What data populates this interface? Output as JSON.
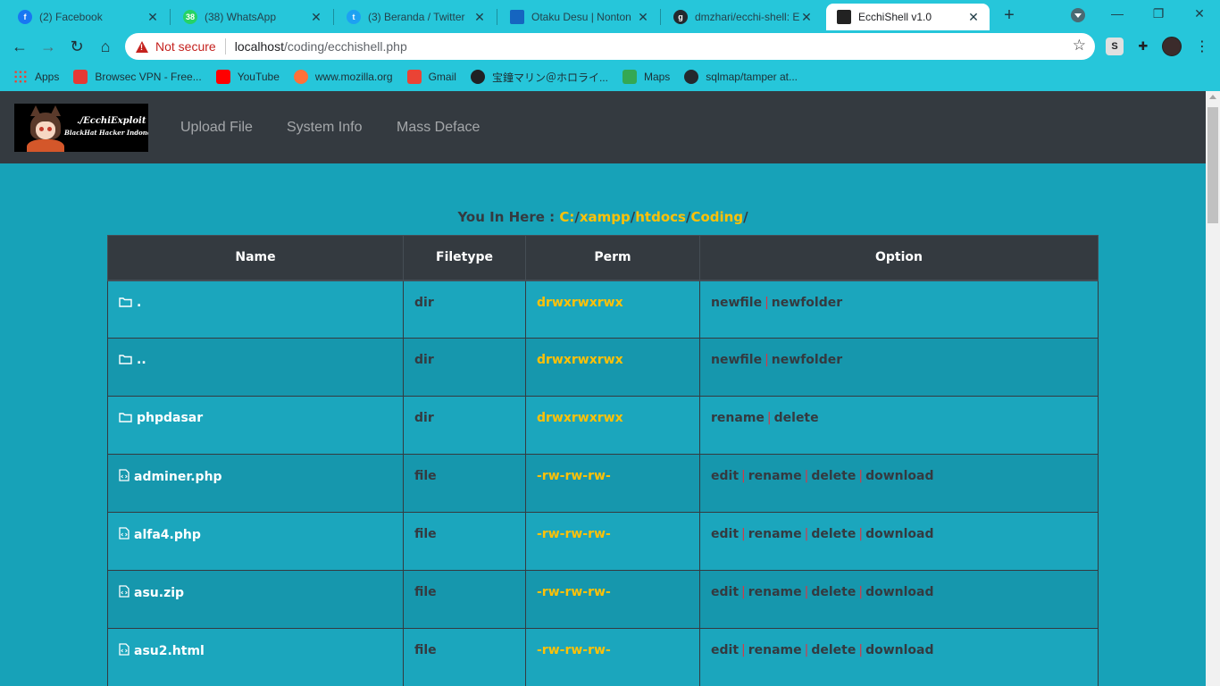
{
  "browser": {
    "tabs": [
      {
        "title": "(2) Facebook",
        "favicon": "facebook-icon",
        "color": "#1877f2",
        "glyph": "f"
      },
      {
        "title": "(38) WhatsApp",
        "favicon": "whatsapp-icon",
        "color": "#25d366",
        "glyph": "38"
      },
      {
        "title": "(3) Beranda / Twitter",
        "favicon": "twitter-icon",
        "color": "#1da1f2",
        "glyph": "t"
      },
      {
        "title": "Otaku Desu | Nonton",
        "favicon": "page-icon",
        "color": "#1565c0",
        "glyph": ""
      },
      {
        "title": "dmzhari/ecchi-shell: Ec",
        "favicon": "github-icon",
        "color": "#24292e",
        "glyph": "g"
      },
      {
        "title": "EcchiShell v1.0",
        "favicon": "ecchishell-icon",
        "color": "#222222",
        "glyph": ""
      }
    ],
    "active_tab": 5,
    "new_tab": "+",
    "window_controls": {
      "minimize": "—",
      "maximize": "❐",
      "close": "✕"
    },
    "nav": {
      "back": "←",
      "forward": "→",
      "reload": "↻",
      "home": "⌂"
    },
    "security_label": "Not secure",
    "url_host": "localhost",
    "url_path": "/coding/ecchishell.php",
    "bookmark_star": "☆",
    "extensions": {
      "s": "S",
      "puzzle": "✚",
      "menu": "⋮"
    },
    "bookmarks": [
      {
        "label": "Apps",
        "icon": "apps-grid-icon",
        "color": "#ea4335"
      },
      {
        "label": "Browsec VPN - Free...",
        "icon": "browsec-icon",
        "color": "#e53935"
      },
      {
        "label": "YouTube",
        "icon": "youtube-icon",
        "color": "#ff0000"
      },
      {
        "label": "www.mozilla.org",
        "icon": "firefox-icon",
        "color": "#ff7139"
      },
      {
        "label": "Gmail",
        "icon": "gmail-icon",
        "color": "#ea4335"
      },
      {
        "label": "宝鐘マリン＠ホロライ...",
        "icon": "globe-icon",
        "color": "#202124"
      },
      {
        "label": "Maps",
        "icon": "maps-icon",
        "color": "#34a853"
      },
      {
        "label": "sqlmap/tamper at...",
        "icon": "github-icon",
        "color": "#24292e"
      }
    ]
  },
  "site": {
    "logo_line1": "./EcchiExploit",
    "logo_line2": "BlackHat Hacker Indonesia",
    "nav": [
      "Upload File",
      "System Info",
      "Mass Deface"
    ],
    "location_label": "You In Here : ",
    "path": [
      "C:",
      "xampp",
      "htdocs",
      "Coding"
    ],
    "table": {
      "headers": [
        "Name",
        "Filetype",
        "Perm",
        "Option"
      ],
      "rows": [
        {
          "name": ".",
          "icon": "folder-icon",
          "type": "dir",
          "perm": "drwxrwxrwx",
          "options": [
            "newfile",
            "newfolder"
          ]
        },
        {
          "name": "..",
          "icon": "folder-icon",
          "type": "dir",
          "perm": "drwxrwxrwx",
          "options": [
            "newfile",
            "newfolder"
          ]
        },
        {
          "name": "phpdasar",
          "icon": "folder-icon",
          "type": "dir",
          "perm": "drwxrwxrwx",
          "options": [
            "rename",
            "delete"
          ]
        },
        {
          "name": "adminer.php",
          "icon": "code-file-icon",
          "type": "file",
          "perm": "-rw-rw-rw-",
          "options": [
            "edit",
            "rename",
            "delete",
            "download"
          ]
        },
        {
          "name": "alfa4.php",
          "icon": "code-file-icon",
          "type": "file",
          "perm": "-rw-rw-rw-",
          "options": [
            "edit",
            "rename",
            "delete",
            "download"
          ]
        },
        {
          "name": "asu.zip",
          "icon": "code-file-icon",
          "type": "file",
          "perm": "-rw-rw-rw-",
          "options": [
            "edit",
            "rename",
            "delete",
            "download"
          ]
        },
        {
          "name": "asu2.html",
          "icon": "code-file-icon",
          "type": "file",
          "perm": "-rw-rw-rw-",
          "options": [
            "edit",
            "rename",
            "delete",
            "download"
          ]
        }
      ]
    }
  },
  "colors": {
    "page_bg": "#17a2b8",
    "navbar_bg": "#343a40",
    "accent_yellow": "#ffc107",
    "separator_red": "#dc3545",
    "chrome_frame": "#26c6da"
  }
}
